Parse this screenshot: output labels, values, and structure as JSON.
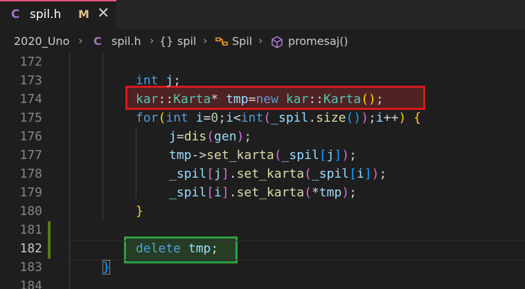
{
  "tab": {
    "lang": "C",
    "filename": "spil.h",
    "modified": "M",
    "close": "✕"
  },
  "breadcrumb": {
    "folder": "2020_Uno",
    "file_icon": "C",
    "file": "spil.h",
    "ns_icon": "{}",
    "namespace": "spil",
    "class": "Spil",
    "method": "promesaj()"
  },
  "lines": [
    {
      "num": "172",
      "text": ""
    },
    {
      "num": "173",
      "text": "int j;"
    },
    {
      "num": "174",
      "text": "kar::Karta* tmp=new kar::Karta();"
    },
    {
      "num": "175",
      "text": "for(int i=0;i<int(_spil.size());i++) {"
    },
    {
      "num": "176",
      "text": "j=dis(gen);"
    },
    {
      "num": "177",
      "text": "tmp->set_karta(_spil[j]);"
    },
    {
      "num": "178",
      "text": "_spil[j].set_karta(_spil[i]);"
    },
    {
      "num": "179",
      "text": "_spil[i].set_karta(*tmp);"
    },
    {
      "num": "180",
      "text": "}"
    },
    {
      "num": "181",
      "text": ""
    },
    {
      "num": "182",
      "text": "delete tmp;"
    },
    {
      "num": "183",
      "text": "}"
    },
    {
      "num": "184",
      "text": ""
    }
  ],
  "colors": {
    "highlight_removed": "#d7191c",
    "highlight_added": "#2ea043",
    "tab_accent": "#e8587a"
  }
}
